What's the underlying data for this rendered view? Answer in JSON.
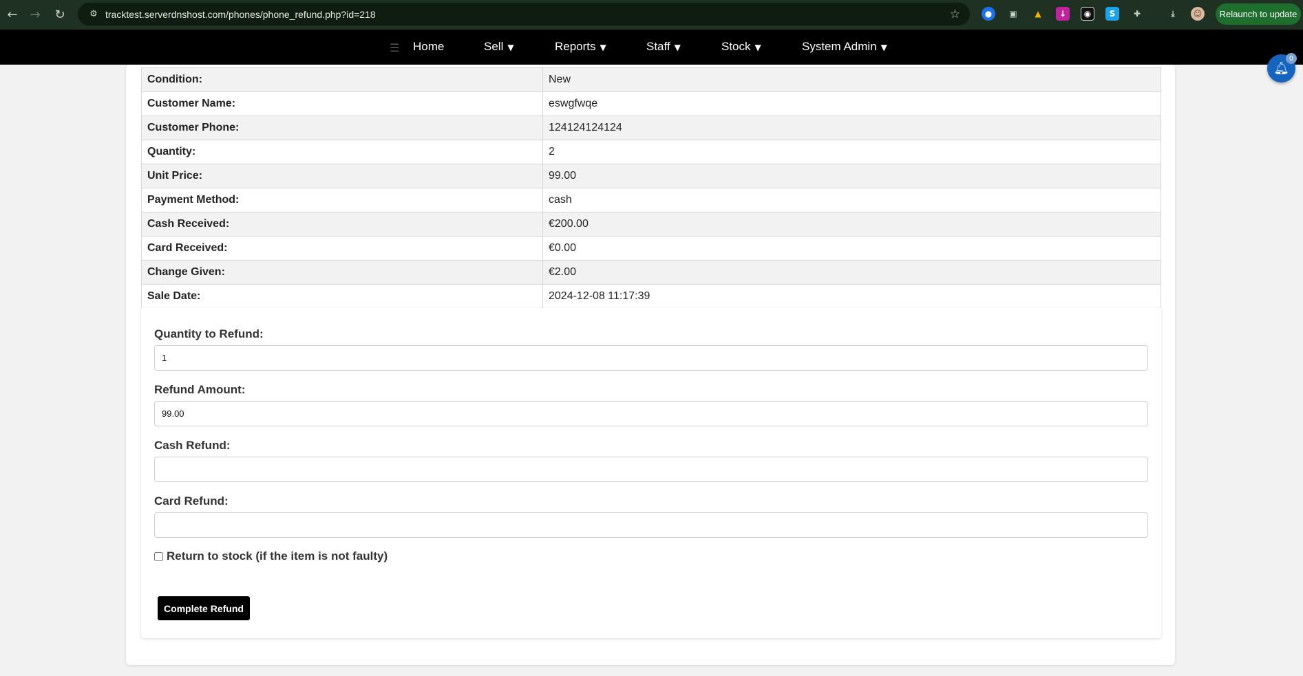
{
  "browser": {
    "url": "tracktest.serverdnshost.com/phones/phone_refund.php?id=218",
    "relaunch_label": "Relaunch to update"
  },
  "navbar": {
    "items": [
      {
        "label": "Home",
        "has_caret": false
      },
      {
        "label": "Sell",
        "has_caret": true
      },
      {
        "label": "Reports",
        "has_caret": true
      },
      {
        "label": "Staff",
        "has_caret": true
      },
      {
        "label": "Stock",
        "has_caret": true
      },
      {
        "label": "System Admin",
        "has_caret": true
      }
    ],
    "caret": "▼"
  },
  "notifications": {
    "count": "0"
  },
  "sale_details": [
    {
      "label": "Condition:",
      "value": "New"
    },
    {
      "label": "Customer Name:",
      "value": "eswgfwqe"
    },
    {
      "label": "Customer Phone:",
      "value": "124124124124"
    },
    {
      "label": "Quantity:",
      "value": "2"
    },
    {
      "label": "Unit Price:",
      "value": "99.00"
    },
    {
      "label": "Payment Method:",
      "value": "cash"
    },
    {
      "label": "Cash Received:",
      "value": "€200.00"
    },
    {
      "label": "Card Received:",
      "value": "€0.00"
    },
    {
      "label": "Change Given:",
      "value": "€2.00"
    },
    {
      "label": "Sale Date:",
      "value": "2024-12-08 11:17:39"
    }
  ],
  "refund_form": {
    "quantity_label": "Quantity to Refund:",
    "quantity_value": "1",
    "amount_label": "Refund Amount:",
    "amount_value": "99.00",
    "cash_label": "Cash Refund:",
    "cash_value": "",
    "card_label": "Card Refund:",
    "card_value": "",
    "return_to_stock_label": "Return to stock (if the item is not faulty)",
    "submit_label": "Complete Refund"
  },
  "colors": {
    "browser_chrome": "#1f3122",
    "navbar": "#000000",
    "bell": "#1565c0",
    "relaunch": "#1e6e2e"
  }
}
